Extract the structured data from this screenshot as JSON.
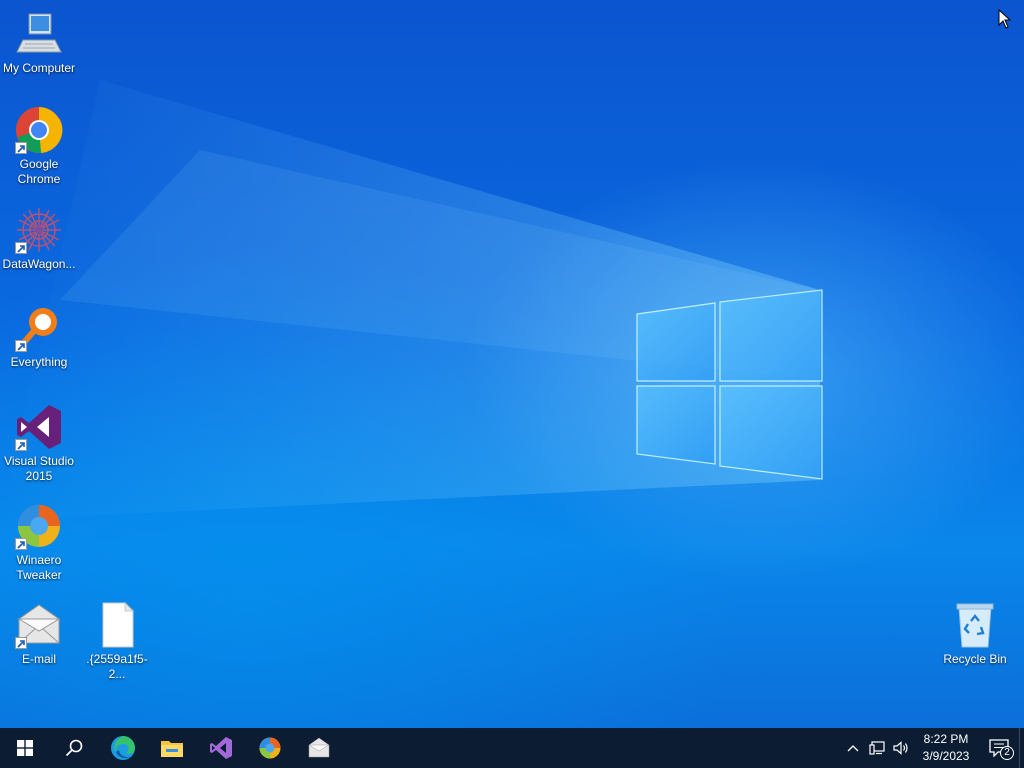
{
  "desktop": {
    "icons": [
      {
        "label": "My Computer",
        "icon": "computer-icon"
      },
      {
        "label": "Google Chrome",
        "icon": "chrome-icon"
      },
      {
        "label": "DataWagon...",
        "icon": "datawagon-icon"
      },
      {
        "label": "Everything",
        "icon": "everything-search-icon"
      },
      {
        "label": "Visual Studio 2015",
        "icon": "visual-studio-icon"
      },
      {
        "label": "Winaero Tweaker",
        "icon": "winaero-tweaker-icon"
      },
      {
        "label": "E-mail",
        "icon": "email-envelope-icon"
      },
      {
        "label": ".{2559a1f5-2...",
        "icon": "blank-file-icon"
      },
      {
        "label": "Recycle Bin",
        "icon": "recycle-bin-icon"
      }
    ]
  },
  "taskbar": {
    "pinned": [
      "start-windows-icon",
      "search-icon",
      "edge-icon",
      "file-explorer-icon",
      "visual-studio-icon",
      "winaero-tweaker-icon",
      "email-icon"
    ],
    "clock": {
      "time": "8:22 PM",
      "date": "3/9/2023"
    },
    "notification_count": "2"
  },
  "colors": {
    "taskbar": "#0c1d33",
    "wallpaper_accent": "#0a6ae0"
  }
}
